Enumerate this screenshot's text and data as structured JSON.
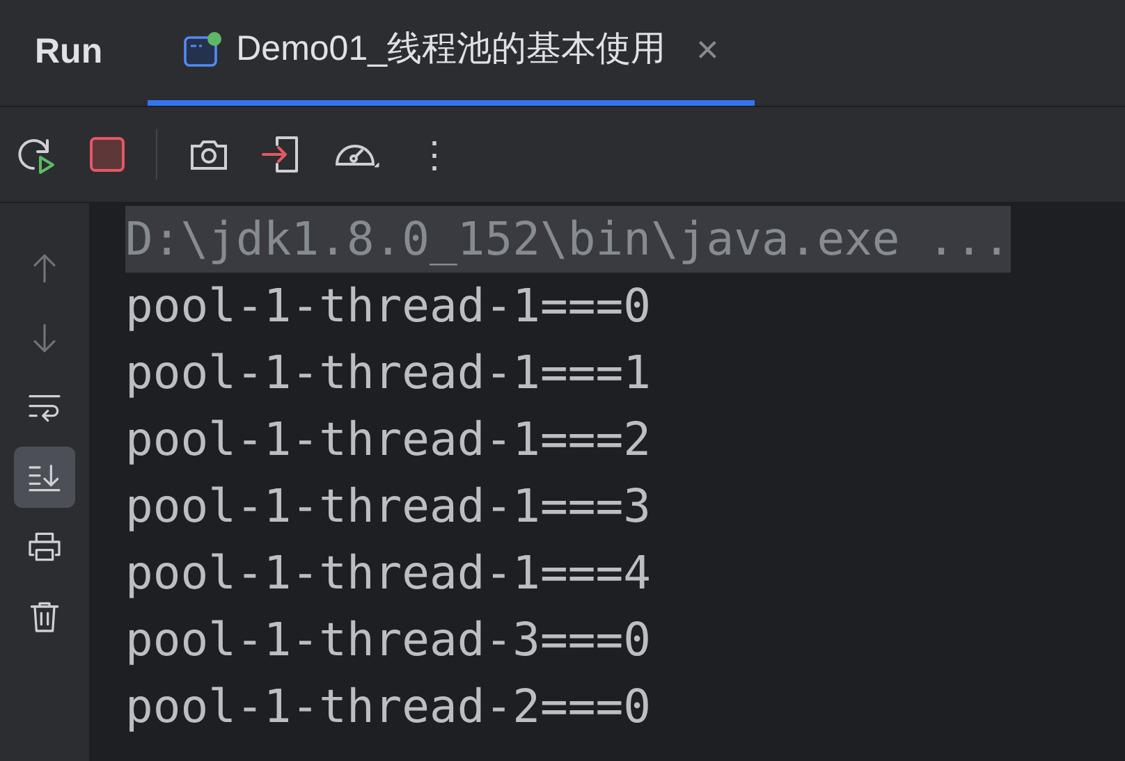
{
  "header": {
    "title": "Run",
    "tabs": [
      {
        "label": "Demo01_线程池的基本使用",
        "selected": true,
        "running": true,
        "close": "×"
      }
    ]
  },
  "toolbar": {
    "more": "⋮"
  },
  "side_tools": [
    {
      "kind": "up",
      "disabled": true,
      "selected": false
    },
    {
      "kind": "down",
      "disabled": true,
      "selected": false
    },
    {
      "kind": "wrap",
      "disabled": false,
      "selected": false
    },
    {
      "kind": "scroll-end",
      "disabled": false,
      "selected": true
    },
    {
      "kind": "print",
      "disabled": false,
      "selected": false
    },
    {
      "kind": "trash",
      "disabled": false,
      "selected": false
    }
  ],
  "console": {
    "lines": [
      {
        "text": "D:\\jdk1.8.0_152\\bin\\java.exe ...",
        "kind": "command"
      },
      {
        "text": "pool-1-thread-1===0",
        "kind": "output"
      },
      {
        "text": "pool-1-thread-1===1",
        "kind": "output"
      },
      {
        "text": "pool-1-thread-1===2",
        "kind": "output"
      },
      {
        "text": "pool-1-thread-1===3",
        "kind": "output"
      },
      {
        "text": "pool-1-thread-1===4",
        "kind": "output"
      },
      {
        "text": "pool-1-thread-3===0",
        "kind": "output"
      },
      {
        "text": "pool-1-thread-2===0",
        "kind": "output"
      }
    ]
  }
}
